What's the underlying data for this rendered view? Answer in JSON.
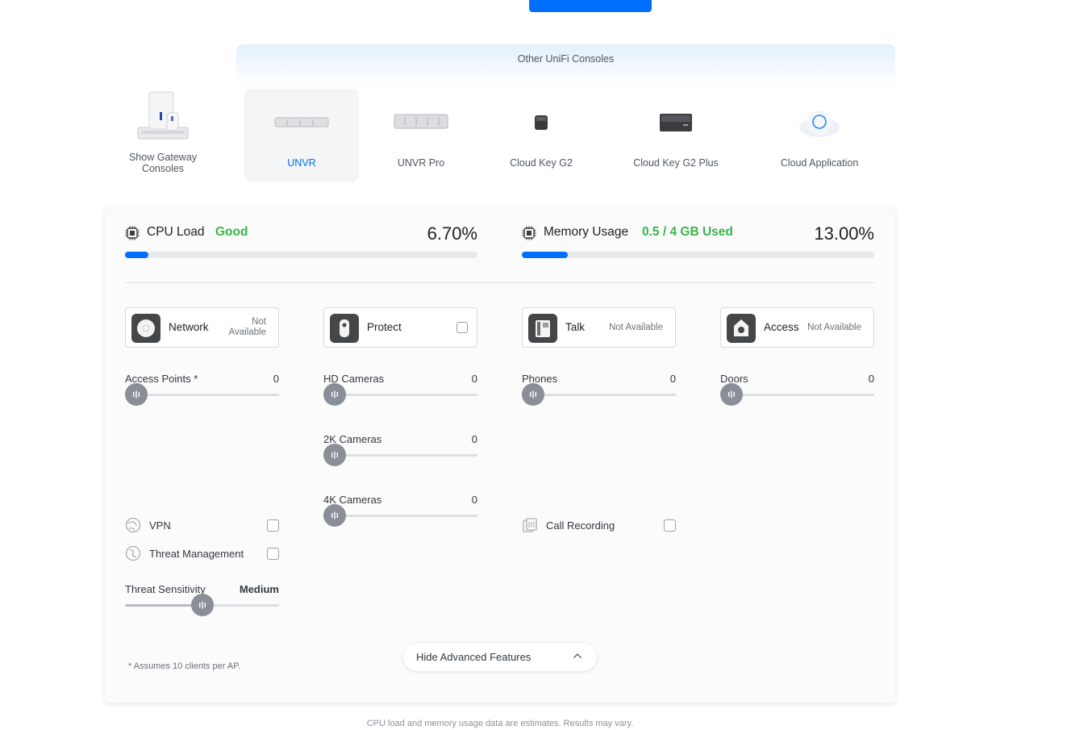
{
  "banner": {
    "title": "Other UniFi Consoles"
  },
  "consoles": [
    {
      "label": "Show Gateway Consoles",
      "selected": false
    },
    {
      "label": "UNVR",
      "selected": true
    },
    {
      "label": "UNVR Pro",
      "selected": false
    },
    {
      "label": "Cloud Key G2",
      "selected": false
    },
    {
      "label": "Cloud Key G2 Plus",
      "selected": false
    },
    {
      "label": "Cloud Application",
      "selected": false
    }
  ],
  "cpu": {
    "label": "CPU Load",
    "status": "Good",
    "value": "6.70%",
    "fill_fraction": 0.067
  },
  "memory": {
    "label": "Memory Usage",
    "status": "0.5 / 4 GB Used",
    "value": "13.00%",
    "fill_fraction": 0.13
  },
  "apps": {
    "network": {
      "name": "Network",
      "availability_line1": "Not",
      "availability_line2": "Available"
    },
    "protect": {
      "name": "Protect",
      "checked": false
    },
    "talk": {
      "name": "Talk",
      "availability": "Not Available"
    },
    "access": {
      "name": "Access",
      "availability": "Not Available"
    }
  },
  "sliders": {
    "access_points": {
      "label": "Access Points *",
      "value": "0",
      "fraction": 0
    },
    "hd_cameras": {
      "label": "HD Cameras",
      "value": "0",
      "fraction": 0
    },
    "cameras_2k": {
      "label": "2K Cameras",
      "value": "0",
      "fraction": 0
    },
    "cameras_4k": {
      "label": "4K Cameras",
      "value": "0",
      "fraction": 0
    },
    "phones": {
      "label": "Phones",
      "value": "0",
      "fraction": 0
    },
    "doors": {
      "label": "Doors",
      "value": "0",
      "fraction": 0
    },
    "threat_sensitivity": {
      "label": "Threat Sensitivity",
      "value": "Medium",
      "fraction": 0.5
    }
  },
  "features": {
    "vpn": {
      "label": "VPN",
      "checked": false
    },
    "threat_management": {
      "label": "Threat Management",
      "checked": false
    },
    "call_recording": {
      "label": "Call Recording",
      "checked": false
    }
  },
  "footnote": "* Assumes 10 clients per AP.",
  "hide_button": {
    "label": "Hide Advanced Features"
  },
  "disclaimer": "CPU load and memory usage data are estimates. Results may vary.",
  "colors": {
    "accent": "#006fff",
    "good": "#39b54a",
    "thumb": "#8a8e96"
  }
}
